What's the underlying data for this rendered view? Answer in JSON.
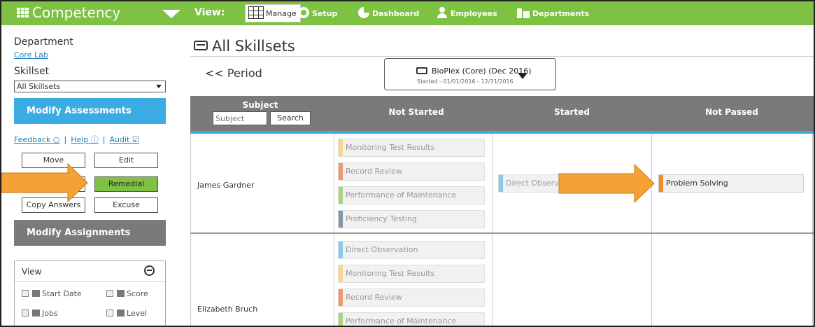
{
  "topbar": {
    "app_name": "Competency",
    "view_label": "View:",
    "nav": {
      "manage": "Manage",
      "setup": "Setup",
      "dashboard": "Dashboard",
      "employees": "Employees",
      "departments": "Departments"
    }
  },
  "sidebar": {
    "department_label": "Department",
    "department_value": "Core Lab",
    "skillset_label": "Skillset",
    "skillset_selected": "All Skillsets",
    "modify_assessments": "Modify Assessments",
    "links": {
      "feedback": "Feedback",
      "help": "Help",
      "audit": "Audit",
      "separator": "|"
    },
    "buttons": {
      "move": "Move",
      "edit": "Edit",
      "remedial": "Remedial",
      "copy_answers": "Copy Answers",
      "excuse": "Excuse"
    },
    "modify_assignments": "Modify Assignments",
    "view_panel": {
      "title": "View",
      "options": {
        "start_date": "Start Date",
        "score": "Score",
        "jobs": "Jobs",
        "level": "Level"
      }
    }
  },
  "main": {
    "title": "All Skillsets",
    "period_link": "<< Period",
    "period": {
      "name": "BioPlex (Core) (Dec 2016)",
      "dates": "Started - 01/01/2016 - 12/31/2016"
    },
    "columns": {
      "subject": "Subject",
      "subject_placeholder": "Subject",
      "search": "Search",
      "not_started": "Not Started",
      "started": "Started",
      "not_passed": "Not Passed"
    },
    "rows": [
      {
        "name": "James Gardner",
        "not_started": [
          "Monitoring Test Results",
          "Record Review",
          "Performance of Maintenance",
          "Proficiency Testing"
        ],
        "started": [
          "Direct Observation"
        ],
        "not_passed": [
          "Problem Solving"
        ]
      },
      {
        "name": "Elizabeth Bruch",
        "not_started": [
          "Direct Observation",
          "Monitoring Test Results",
          "Record Review",
          "Performance of Maintenance"
        ]
      }
    ]
  },
  "colors": {
    "brand_green": "#7dc242",
    "accent_blue": "#3aace3",
    "header_gray": "#7a7a7a",
    "annotation_orange": "#f4a235",
    "skill_monitoring": "#f5d78e",
    "skill_record": "#ef9a6b",
    "skill_performance": "#a9d37e",
    "skill_proficiency": "#8096ad",
    "skill_direct": "#86cbe9",
    "skill_problem": "#f08a24"
  }
}
